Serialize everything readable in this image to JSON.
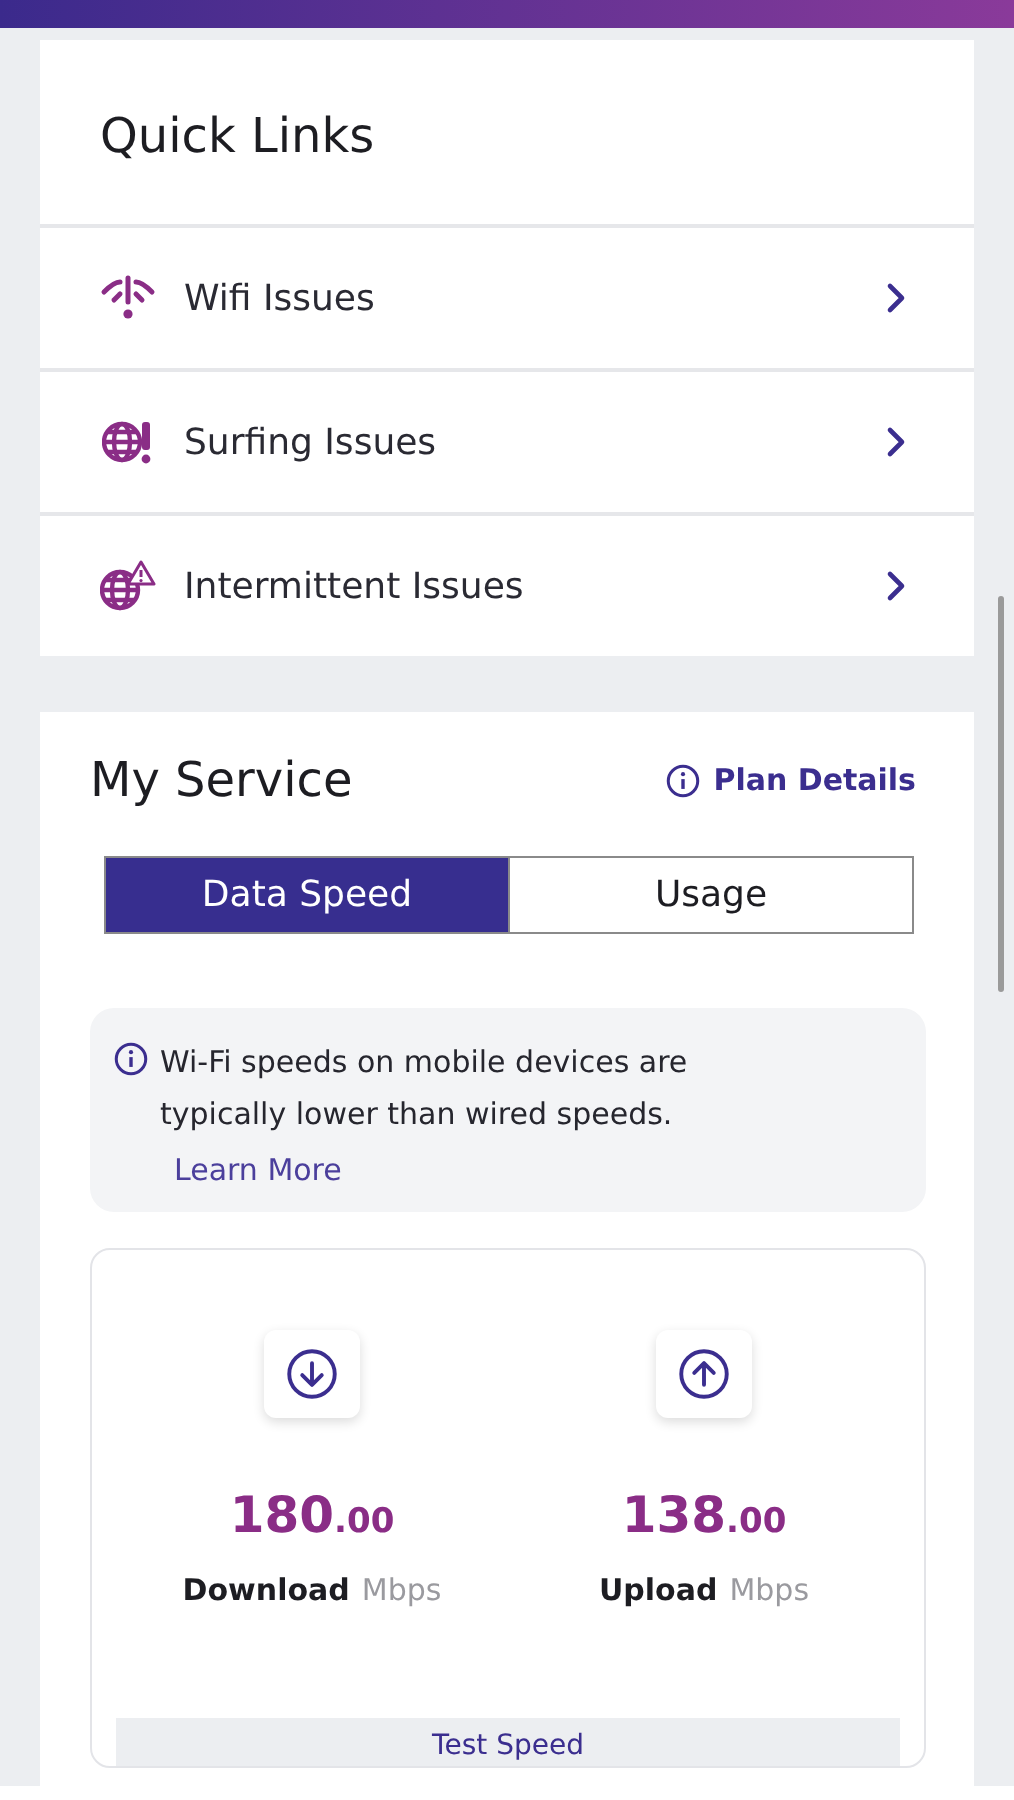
{
  "quick_links": {
    "title": "Quick Links",
    "items": [
      {
        "label": "Wifi Issues",
        "kind": "wifi"
      },
      {
        "label": "Surfing Issues",
        "kind": "globe-alert"
      },
      {
        "label": "Intermittent Issues",
        "kind": "globe-warning"
      }
    ]
  },
  "my_service": {
    "title": "My Service",
    "plan_link": "Plan Details",
    "tabs": [
      {
        "label": "Data Speed",
        "selected": true
      },
      {
        "label": "Usage",
        "selected": false
      }
    ],
    "notice": {
      "text": "Wi-Fi speeds on mobile devices are typically lower than wired speeds.",
      "link": "Learn More"
    },
    "speeds": [
      {
        "kind": "down",
        "value": "180",
        "decimals": ".00",
        "label": "Download",
        "unit": "Mbps"
      },
      {
        "kind": "up",
        "value": "138",
        "decimals": ".00",
        "label": "Upload",
        "unit": "Mbps"
      }
    ],
    "test_button": "Test Speed"
  }
}
